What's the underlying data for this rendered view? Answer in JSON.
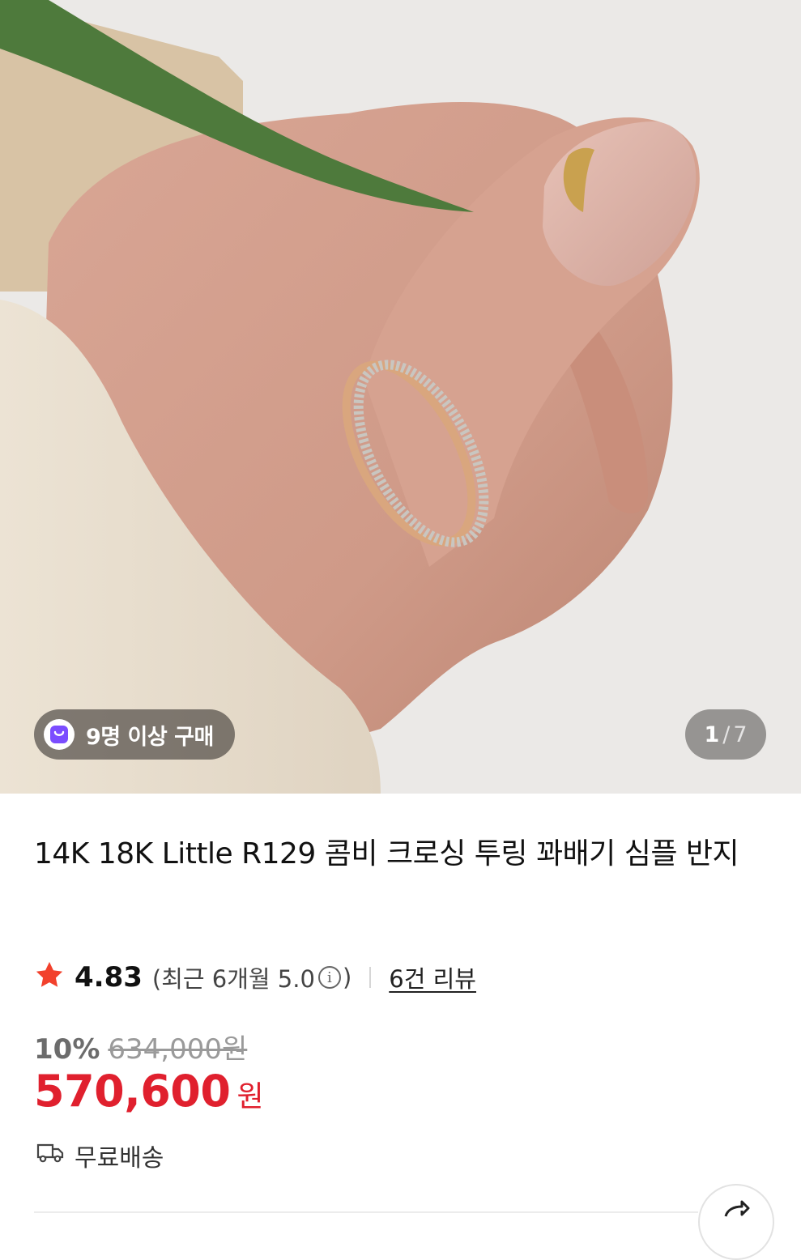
{
  "gallery": {
    "badge_text": "9명 이상 구매",
    "badge_icon": "shopping-bag-icon",
    "badge_icon_color": "#7b4dff",
    "pager_current": "1",
    "pager_separator": "/",
    "pager_total": "7"
  },
  "product": {
    "title": "14K 18K Little R129 콤비 크로싱 투링 꽈배기 심플 반지"
  },
  "rating": {
    "score": "4.83",
    "recent_prefix": "(최근 6개월 5.0",
    "recent_suffix": ")",
    "review_link": "6건 리뷰",
    "star_color": "#f2412c"
  },
  "price": {
    "discount_rate": "10%",
    "original_price": "634,000원",
    "sale_price": "570,600",
    "currency": "원",
    "sale_color": "#e0202e"
  },
  "shipping": {
    "label": "무료배송",
    "icon": "truck-icon"
  }
}
